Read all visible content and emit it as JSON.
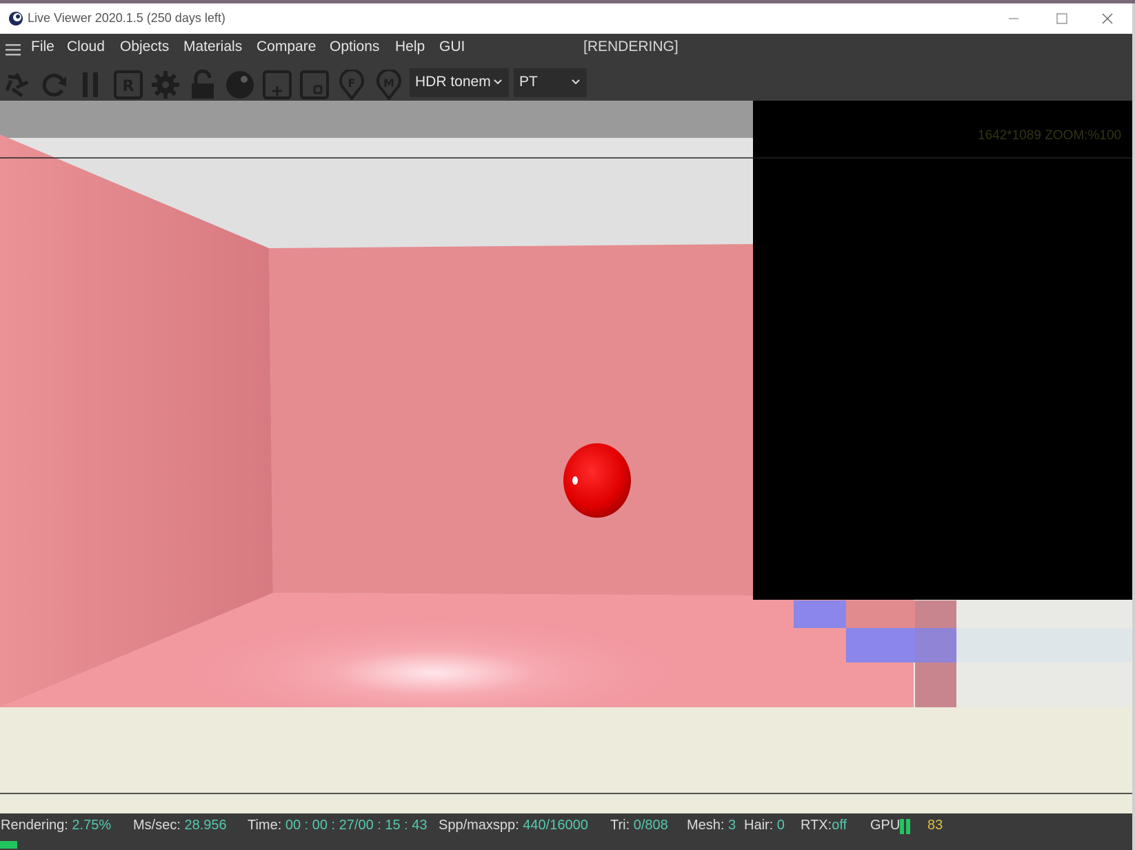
{
  "window": {
    "title": "Live Viewer 2020.1.5 (250 days left)"
  },
  "menu": {
    "items": [
      "File",
      "Cloud",
      "Objects",
      "Materials",
      "Compare",
      "Options",
      "Help",
      "GUI"
    ],
    "render_status": "[RENDERING]"
  },
  "toolbar": {
    "icons": [
      "shutter-icon",
      "refresh-icon",
      "pause-icon",
      "region-r-icon",
      "gear-icon",
      "lock-icon",
      "sphere-icon",
      "add-region-icon",
      "small-region-icon",
      "focus-f-icon",
      "material-m-icon"
    ],
    "tonemap_select": "HDR tonem",
    "kernel_select": "PT"
  },
  "viewport": {
    "zoom_info": "1642*1089 ZOOM:%100"
  },
  "status": {
    "rendering_label": "Rendering:",
    "rendering_value": "2.75%",
    "mssec_label": "Ms/sec:",
    "mssec_value": "28.956",
    "time_label": "Time:",
    "time_value": "00 : 00 : 27/00 : 15 : 43",
    "spp_label": "Spp/maxspp:",
    "spp_value": "440/16000",
    "tri_label": "Tri:",
    "tri_value": "0/808",
    "mesh_label": "Mesh:",
    "mesh_value": "3",
    "hair_label": "Hair:",
    "hair_value": "0",
    "rtx_label": "RTX:",
    "rtx_value": "off",
    "gpu_label": "GPU:",
    "gpu_temp": "83",
    "progress": 0.0275
  },
  "colors": {
    "accent_value": "#55c9b0",
    "progress": "#22c55e",
    "gpu_temp": "#e0c040"
  }
}
